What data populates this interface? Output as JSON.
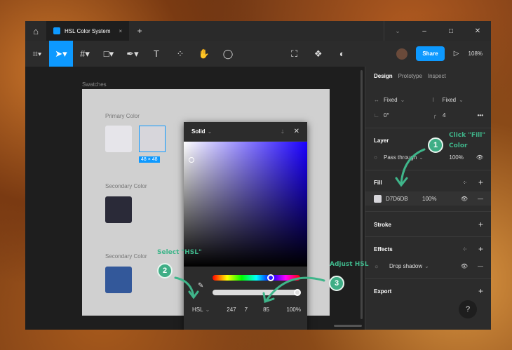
{
  "tab": {
    "title": "HSL Color System",
    "close": "×",
    "new": "+"
  },
  "window": {
    "chevron": "⌄",
    "min": "–",
    "max": "□",
    "close": "✕"
  },
  "toolbar": {
    "share": "Share",
    "zoom": "108%"
  },
  "canvas": {
    "frame_label": "Swatches",
    "primary_label": "Primary Color",
    "secondary_label_1": "Secondary Color",
    "secondary_label_2": "Secondary Color",
    "size_badge": "48 × 48"
  },
  "colors": {
    "primary": "#e6e5ea",
    "selected": "#D7D6DB",
    "secondary1": "#2a2a38",
    "secondary2": "#33589a",
    "accent": "#0d99ff"
  },
  "panel": {
    "tabs": [
      "Design",
      "Prototype",
      "Inspect"
    ],
    "width_mode": "Fixed",
    "height_mode": "Fixed",
    "rotation": "0°",
    "radius": "4",
    "layer_title": "Layer",
    "blend": "Pass through",
    "layer_opacity": "100%",
    "fill_title": "Fill",
    "fill_hex": "D7D6DB",
    "fill_opacity": "100%",
    "stroke_title": "Stroke",
    "effects_title": "Effects",
    "effect": "Drop shadow",
    "export_title": "Export",
    "help": "?"
  },
  "picker": {
    "mode": "Solid",
    "color_model": "HSL",
    "h": "247",
    "s": "7",
    "l": "85",
    "alpha": "100%"
  },
  "annotations": {
    "step1": "1",
    "step1_text": "Click \"Fill\" Color",
    "step2": "2",
    "step2_text": "Select \"HSL\"",
    "step3": "3",
    "step3_text": "Adjust HSL"
  }
}
